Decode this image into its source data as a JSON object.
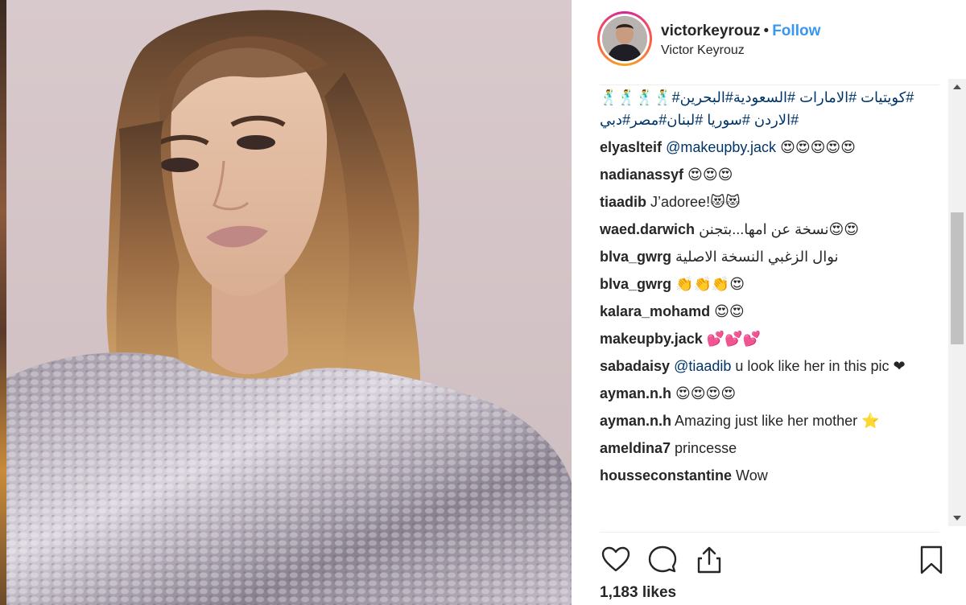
{
  "header": {
    "username": "victorkeyrouz",
    "separator": "•",
    "follow_label": "Follow",
    "full_name": "Victor Keyrouz"
  },
  "caption": {
    "line1": "#كويتيات  #الامارات  #السعودية#البحرين#🕺🕺🕺🕺",
    "line2": "#الاردن  #سوريا  #لبنان#مصر#دبي"
  },
  "comments": [
    {
      "user": "elyaslteif",
      "mention": "@makeupby.jack",
      "text": " 😍😍😍😍😍"
    },
    {
      "user": "nadianassyf",
      "mention": "",
      "text": " 😍😍😍"
    },
    {
      "user": "tiaadib",
      "mention": "",
      "text": " J’adoree!😻😻"
    },
    {
      "user": "waed.darwich",
      "mention": "",
      "text": " نسخة عن امها...بتجنن😍😍"
    },
    {
      "user": "blva_gwrg",
      "mention": "",
      "text": " نوال الزغبي النسخة الاصلية"
    },
    {
      "user": "blva_gwrg",
      "mention": "",
      "text": " 👏👏👏😍"
    },
    {
      "user": "kalara_mohamd",
      "mention": "",
      "text": " 😍😍"
    },
    {
      "user": "makeupby.jack",
      "mention": "",
      "text": " 💕💕💕"
    },
    {
      "user": "sabadaisy",
      "mention": "@tiaadib",
      "text": " u look like her in this pic ❤"
    },
    {
      "user": "ayman.n.h",
      "mention": "",
      "text": " 😍😍😍😍"
    },
    {
      "user": "ayman.n.h",
      "mention": "",
      "text": " Amazing just like her mother ⭐"
    },
    {
      "user": "ameldina7",
      "mention": "",
      "text": " princesse"
    },
    {
      "user": "housseconstantine",
      "mention": "",
      "text": " Wow"
    }
  ],
  "actions": {
    "like_icon": "heart-icon",
    "comment_icon": "comment-icon",
    "share_icon": "share-icon",
    "save_icon": "bookmark-icon"
  },
  "likes": "1,183 likes",
  "colors": {
    "follow": "#3897f0",
    "hashtag": "#003569",
    "text": "#262626",
    "divider": "#efefef"
  }
}
